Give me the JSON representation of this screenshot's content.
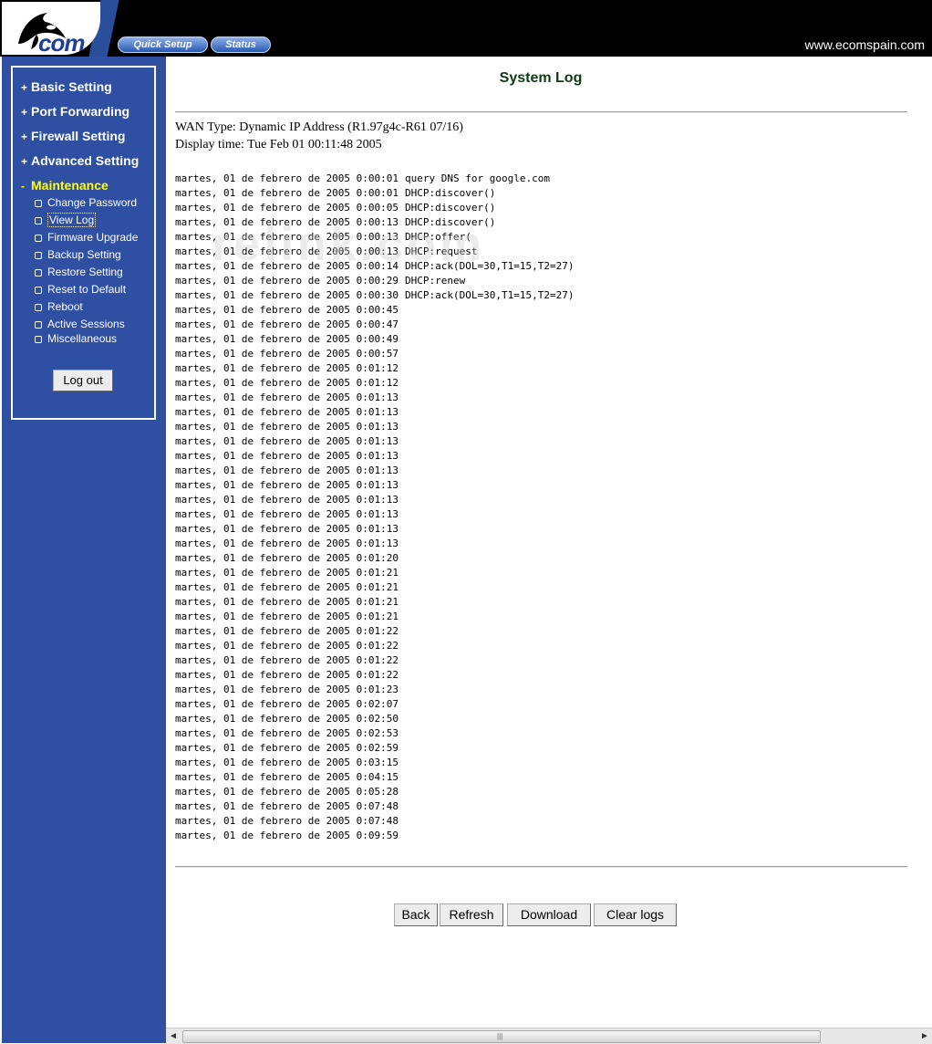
{
  "header": {
    "logo_text": "com",
    "nav": [
      {
        "label": "Quick Setup"
      },
      {
        "label": "Status"
      }
    ],
    "site_url": "www.ecomspain.com"
  },
  "sidebar": {
    "main_items": [
      {
        "sign": "+",
        "label": "Basic Setting"
      },
      {
        "sign": "+",
        "label": "Port Forwarding"
      },
      {
        "sign": "+",
        "label": "Firewall Setting"
      },
      {
        "sign": "+",
        "label": "Advanced Setting"
      },
      {
        "sign": "-",
        "label": "Maintenance"
      }
    ],
    "sub_items": [
      {
        "label": "Change Password"
      },
      {
        "label": "View Log"
      },
      {
        "label": "Firmware Upgrade"
      },
      {
        "label": "Backup Setting"
      },
      {
        "label": "Restore Setting"
      },
      {
        "label": "Reset to Default"
      },
      {
        "label": "Reboot"
      },
      {
        "label": "Active Sessions"
      },
      {
        "label": "Miscellaneous"
      }
    ],
    "logout_label": "Log out"
  },
  "main": {
    "title": "System Log",
    "wan_type": "WAN Type: Dynamic IP Address (R1.97g4c-R61 07/16)",
    "display_time": "Display time: Tue Feb 01 00:11:48 2005",
    "watermark": "relink.com",
    "log_entries": [
      {
        "date": "martes, 01 de febrero de 2005 0:00:01",
        "msg": "query DNS for google.com"
      },
      {
        "date": "martes, 01 de febrero de 2005 0:00:01",
        "msg": "DHCP:discover()"
      },
      {
        "date": "martes, 01 de febrero de 2005 0:00:05",
        "msg": "DHCP:discover()"
      },
      {
        "date": "martes, 01 de febrero de 2005 0:00:13",
        "msg": "DHCP:discover()"
      },
      {
        "date": "martes, 01 de febrero de 2005 0:00:13",
        "msg": "DHCP:offer("
      },
      {
        "date": "martes, 01 de febrero de 2005 0:00:13",
        "msg": "DHCP:request"
      },
      {
        "date": "martes, 01 de febrero de 2005 0:00:14",
        "msg": "DHCP:ack(DOL=30,T1=15,T2=27)"
      },
      {
        "date": "martes, 01 de febrero de 2005 0:00:29",
        "msg": "DHCP:renew"
      },
      {
        "date": "martes, 01 de febrero de 2005 0:00:30",
        "msg": "DHCP:ack(DOL=30,T1=15,T2=27)"
      },
      {
        "date": "martes, 01 de febrero de 2005 0:00:45",
        "msg": ""
      },
      {
        "date": "martes, 01 de febrero de 2005 0:00:47",
        "msg": ""
      },
      {
        "date": "martes, 01 de febrero de 2005 0:00:49",
        "msg": ""
      },
      {
        "date": "martes, 01 de febrero de 2005 0:00:57",
        "msg": ""
      },
      {
        "date": "martes, 01 de febrero de 2005 0:01:12",
        "msg": ""
      },
      {
        "date": "martes, 01 de febrero de 2005 0:01:12",
        "msg": ""
      },
      {
        "date": "martes, 01 de febrero de 2005 0:01:13",
        "msg": ""
      },
      {
        "date": "martes, 01 de febrero de 2005 0:01:13",
        "msg": ""
      },
      {
        "date": "martes, 01 de febrero de 2005 0:01:13",
        "msg": ""
      },
      {
        "date": "martes, 01 de febrero de 2005 0:01:13",
        "msg": ""
      },
      {
        "date": "martes, 01 de febrero de 2005 0:01:13",
        "msg": ""
      },
      {
        "date": "martes, 01 de febrero de 2005 0:01:13",
        "msg": ""
      },
      {
        "date": "martes, 01 de febrero de 2005 0:01:13",
        "msg": ""
      },
      {
        "date": "martes, 01 de febrero de 2005 0:01:13",
        "msg": ""
      },
      {
        "date": "martes, 01 de febrero de 2005 0:01:13",
        "msg": ""
      },
      {
        "date": "martes, 01 de febrero de 2005 0:01:13",
        "msg": ""
      },
      {
        "date": "martes, 01 de febrero de 2005 0:01:13",
        "msg": ""
      },
      {
        "date": "martes, 01 de febrero de 2005 0:01:20",
        "msg": ""
      },
      {
        "date": "martes, 01 de febrero de 2005 0:01:21",
        "msg": ""
      },
      {
        "date": "martes, 01 de febrero de 2005 0:01:21",
        "msg": ""
      },
      {
        "date": "martes, 01 de febrero de 2005 0:01:21",
        "msg": ""
      },
      {
        "date": "martes, 01 de febrero de 2005 0:01:21",
        "msg": ""
      },
      {
        "date": "martes, 01 de febrero de 2005 0:01:22",
        "msg": ""
      },
      {
        "date": "martes, 01 de febrero de 2005 0:01:22",
        "msg": ""
      },
      {
        "date": "martes, 01 de febrero de 2005 0:01:22",
        "msg": ""
      },
      {
        "date": "martes, 01 de febrero de 2005 0:01:22",
        "msg": ""
      },
      {
        "date": "martes, 01 de febrero de 2005 0:01:23",
        "msg": ""
      },
      {
        "date": "martes, 01 de febrero de 2005 0:02:07",
        "msg": ""
      },
      {
        "date": "martes, 01 de febrero de 2005 0:02:50",
        "msg": ""
      },
      {
        "date": "martes, 01 de febrero de 2005 0:02:53",
        "msg": ""
      },
      {
        "date": "martes, 01 de febrero de 2005 0:02:59",
        "msg": ""
      },
      {
        "date": "martes, 01 de febrero de 2005 0:03:15",
        "msg": ""
      },
      {
        "date": "martes, 01 de febrero de 2005 0:04:15",
        "msg": ""
      },
      {
        "date": "martes, 01 de febrero de 2005 0:05:28",
        "msg": ""
      },
      {
        "date": "martes, 01 de febrero de 2005 0:07:48",
        "msg": ""
      },
      {
        "date": "martes, 01 de febrero de 2005 0:07:48",
        "msg": ""
      },
      {
        "date": "martes, 01 de febrero de 2005 0:09:59",
        "msg": ""
      }
    ],
    "buttons": {
      "back": "Back",
      "refresh": "Refresh",
      "download": "Download",
      "clear": "Clear logs"
    }
  },
  "scrollbar": {
    "left_arrow": "◄",
    "right_arrow": "►",
    "grip": "|||"
  },
  "colors": {
    "sidebar_bg": "#2f4fa3",
    "header_bg": "#000000",
    "active_menu": "#ffff00",
    "title_color": "#0e3b17"
  }
}
